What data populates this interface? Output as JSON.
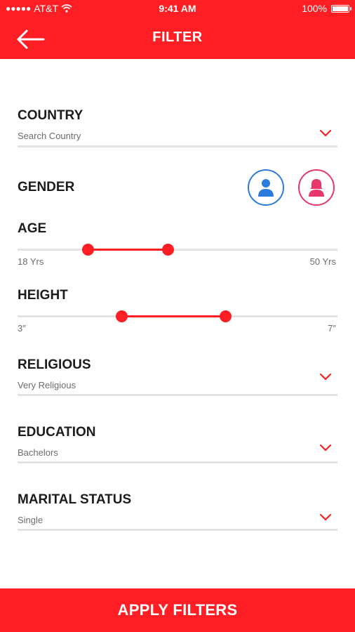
{
  "status_bar": {
    "carrier": "AT&T",
    "time": "9:41 AM",
    "battery": "100%"
  },
  "header": {
    "title": "FILTER",
    "back_icon": "arrow-left-icon"
  },
  "country": {
    "label": "COUNTRY",
    "placeholder": "Search Country"
  },
  "gender": {
    "label": "GENDER",
    "male_icon": "male-user-icon",
    "female_icon": "female-user-icon",
    "male_color": "#2b7bdc",
    "female_color": "#e8376b"
  },
  "age": {
    "label": "AGE",
    "min_label": "18 Yrs",
    "max_label": "50 Yrs",
    "range_min": 18,
    "range_max": 50,
    "selected_low": 25,
    "selected_high": 33
  },
  "height": {
    "label": "HEIGHT",
    "min_label": "3″",
    "max_label": "7″",
    "range_min": 3,
    "range_max": 7,
    "selected_low": 4.3,
    "selected_high": 5.6
  },
  "religious": {
    "label": "RELIGIOUS",
    "value": "Very Religious"
  },
  "education": {
    "label": "EDUCATION",
    "value": "Bachelors"
  },
  "marital_status": {
    "label": "MARITAL STATUS",
    "value": "Single"
  },
  "apply_button": {
    "label": "APPLY FILTERS"
  },
  "colors": {
    "accent": "#ff1e23",
    "divider": "#e3e3e3"
  }
}
